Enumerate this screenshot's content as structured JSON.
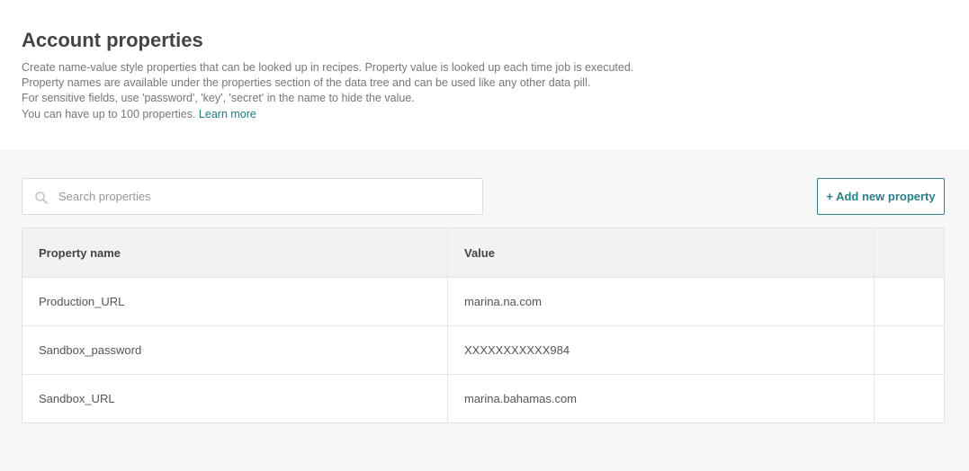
{
  "header": {
    "title": "Account properties",
    "lines": [
      "Create name-value style properties that can be looked up in recipes. Property value is looked up each time job is executed.",
      "Property names are available under the properties section of the data tree and can be used like any other data pill.",
      "For sensitive fields, use 'password', 'key', 'secret' in the name to hide the value.",
      "You can have up to 100 properties."
    ],
    "learn_more": "Learn more"
  },
  "search": {
    "placeholder": "Search properties",
    "value": ""
  },
  "toolbar": {
    "add_label": "+ Add new property"
  },
  "table": {
    "columns": [
      "Property name",
      "Value",
      ""
    ],
    "rows": [
      {
        "name": "Production_URL",
        "value": "marina.na.com"
      },
      {
        "name": "Sandbox_password",
        "value": "XXXXXXXXXXX984"
      },
      {
        "name": "Sandbox_URL",
        "value": "marina.bahamas.com"
      }
    ]
  },
  "colors": {
    "accent": "#2b7f86",
    "link": "#1e7d83",
    "background": "#f7f7f7"
  },
  "icons": {
    "search": "search-icon"
  }
}
